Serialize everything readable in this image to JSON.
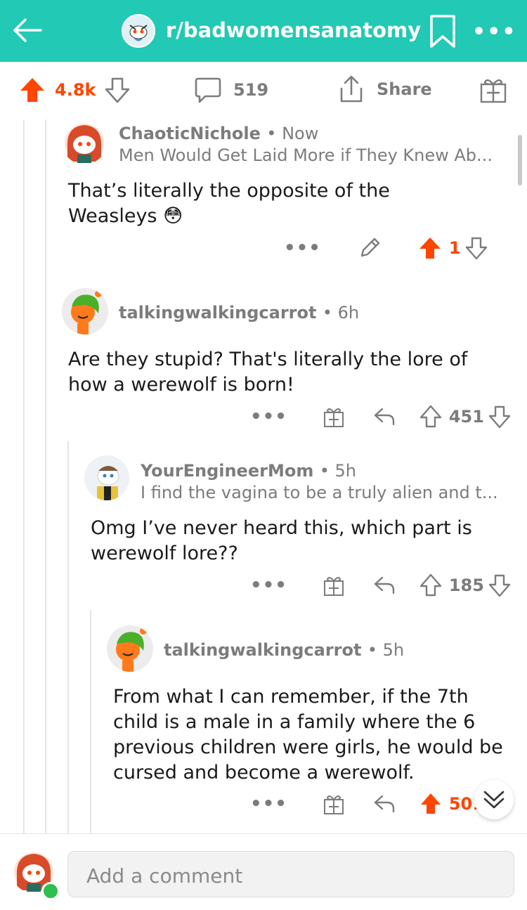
{
  "header": {
    "subreddit": "r/badwomensanatomy",
    "back_icon": "back-arrow-icon",
    "bookmark_icon": "bookmark-icon",
    "more_label": "•••"
  },
  "post_actions": {
    "upvotes": "4.8k",
    "comments": "519",
    "share_label": "Share"
  },
  "comments": [
    {
      "user": "ChaoticNichole",
      "time": "• Now",
      "context": "Men Would Get Laid More if They Knew Ab...",
      "body": "That’s literally the opposite of the Weasleys 😳",
      "score": "1",
      "upvoted": true,
      "more_label": "•••"
    },
    {
      "user": "talkingwalkingcarrot",
      "time": "• 6h",
      "body": "Are they stupid? That's literally the lore of how a werewolf is born!",
      "score": "451",
      "upvoted": false,
      "more_label": "•••"
    },
    {
      "user": "YourEngineerMom",
      "time": "• 5h",
      "context": "I find the vagina to be a truly alien and t...",
      "body": "Omg I’ve never heard this, which part is werewolf lore??",
      "score": "185",
      "upvoted": false,
      "more_label": "•••"
    },
    {
      "user": "talkingwalkingcarrot",
      "time": "• 5h",
      "body": "From what I can remember, if the 7th child is a male in a family where the 6 previous children were girls, he would be cursed and become a werewolf.",
      "score": "501",
      "upvoted": true,
      "more_label": "•••"
    }
  ],
  "composer": {
    "placeholder": "Add a comment"
  },
  "colors": {
    "header_bg": "#22c9b5",
    "upvote": "#ff4500",
    "muted": "#7c7c7c"
  }
}
